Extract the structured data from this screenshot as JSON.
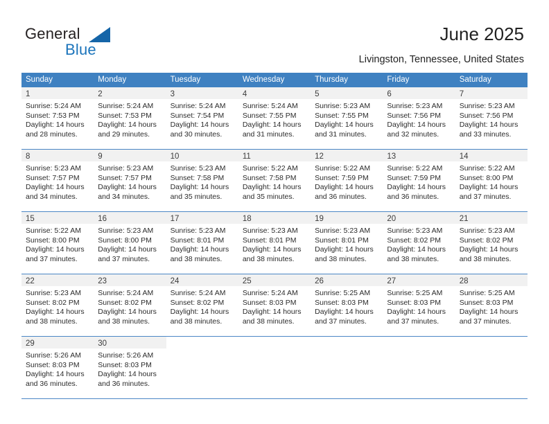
{
  "brand": {
    "name_part1": "General",
    "name_part2": "Blue",
    "accent_color": "#1b74bb",
    "triangle_color": "#1565a8"
  },
  "header": {
    "title": "June 2025",
    "location": "Livingston, Tennessee, United States"
  },
  "calendar": {
    "header_bg": "#3f81c1",
    "row_separator_color": "#4a86c5",
    "daynum_band_color": "#f1f1f1",
    "weekdays": [
      "Sunday",
      "Monday",
      "Tuesday",
      "Wednesday",
      "Thursday",
      "Friday",
      "Saturday"
    ],
    "weeks": [
      [
        {
          "day": "1",
          "sunrise": "Sunrise: 5:24 AM",
          "sunset": "Sunset: 7:53 PM",
          "daylight_line1": "Daylight: 14 hours",
          "daylight_line2": "and 28 minutes."
        },
        {
          "day": "2",
          "sunrise": "Sunrise: 5:24 AM",
          "sunset": "Sunset: 7:53 PM",
          "daylight_line1": "Daylight: 14 hours",
          "daylight_line2": "and 29 minutes."
        },
        {
          "day": "3",
          "sunrise": "Sunrise: 5:24 AM",
          "sunset": "Sunset: 7:54 PM",
          "daylight_line1": "Daylight: 14 hours",
          "daylight_line2": "and 30 minutes."
        },
        {
          "day": "4",
          "sunrise": "Sunrise: 5:24 AM",
          "sunset": "Sunset: 7:55 PM",
          "daylight_line1": "Daylight: 14 hours",
          "daylight_line2": "and 31 minutes."
        },
        {
          "day": "5",
          "sunrise": "Sunrise: 5:23 AM",
          "sunset": "Sunset: 7:55 PM",
          "daylight_line1": "Daylight: 14 hours",
          "daylight_line2": "and 31 minutes."
        },
        {
          "day": "6",
          "sunrise": "Sunrise: 5:23 AM",
          "sunset": "Sunset: 7:56 PM",
          "daylight_line1": "Daylight: 14 hours",
          "daylight_line2": "and 32 minutes."
        },
        {
          "day": "7",
          "sunrise": "Sunrise: 5:23 AM",
          "sunset": "Sunset: 7:56 PM",
          "daylight_line1": "Daylight: 14 hours",
          "daylight_line2": "and 33 minutes."
        }
      ],
      [
        {
          "day": "8",
          "sunrise": "Sunrise: 5:23 AM",
          "sunset": "Sunset: 7:57 PM",
          "daylight_line1": "Daylight: 14 hours",
          "daylight_line2": "and 34 minutes."
        },
        {
          "day": "9",
          "sunrise": "Sunrise: 5:23 AM",
          "sunset": "Sunset: 7:57 PM",
          "daylight_line1": "Daylight: 14 hours",
          "daylight_line2": "and 34 minutes."
        },
        {
          "day": "10",
          "sunrise": "Sunrise: 5:23 AM",
          "sunset": "Sunset: 7:58 PM",
          "daylight_line1": "Daylight: 14 hours",
          "daylight_line2": "and 35 minutes."
        },
        {
          "day": "11",
          "sunrise": "Sunrise: 5:22 AM",
          "sunset": "Sunset: 7:58 PM",
          "daylight_line1": "Daylight: 14 hours",
          "daylight_line2": "and 35 minutes."
        },
        {
          "day": "12",
          "sunrise": "Sunrise: 5:22 AM",
          "sunset": "Sunset: 7:59 PM",
          "daylight_line1": "Daylight: 14 hours",
          "daylight_line2": "and 36 minutes."
        },
        {
          "day": "13",
          "sunrise": "Sunrise: 5:22 AM",
          "sunset": "Sunset: 7:59 PM",
          "daylight_line1": "Daylight: 14 hours",
          "daylight_line2": "and 36 minutes."
        },
        {
          "day": "14",
          "sunrise": "Sunrise: 5:22 AM",
          "sunset": "Sunset: 8:00 PM",
          "daylight_line1": "Daylight: 14 hours",
          "daylight_line2": "and 37 minutes."
        }
      ],
      [
        {
          "day": "15",
          "sunrise": "Sunrise: 5:22 AM",
          "sunset": "Sunset: 8:00 PM",
          "daylight_line1": "Daylight: 14 hours",
          "daylight_line2": "and 37 minutes."
        },
        {
          "day": "16",
          "sunrise": "Sunrise: 5:23 AM",
          "sunset": "Sunset: 8:00 PM",
          "daylight_line1": "Daylight: 14 hours",
          "daylight_line2": "and 37 minutes."
        },
        {
          "day": "17",
          "sunrise": "Sunrise: 5:23 AM",
          "sunset": "Sunset: 8:01 PM",
          "daylight_line1": "Daylight: 14 hours",
          "daylight_line2": "and 38 minutes."
        },
        {
          "day": "18",
          "sunrise": "Sunrise: 5:23 AM",
          "sunset": "Sunset: 8:01 PM",
          "daylight_line1": "Daylight: 14 hours",
          "daylight_line2": "and 38 minutes."
        },
        {
          "day": "19",
          "sunrise": "Sunrise: 5:23 AM",
          "sunset": "Sunset: 8:01 PM",
          "daylight_line1": "Daylight: 14 hours",
          "daylight_line2": "and 38 minutes."
        },
        {
          "day": "20",
          "sunrise": "Sunrise: 5:23 AM",
          "sunset": "Sunset: 8:02 PM",
          "daylight_line1": "Daylight: 14 hours",
          "daylight_line2": "and 38 minutes."
        },
        {
          "day": "21",
          "sunrise": "Sunrise: 5:23 AM",
          "sunset": "Sunset: 8:02 PM",
          "daylight_line1": "Daylight: 14 hours",
          "daylight_line2": "and 38 minutes."
        }
      ],
      [
        {
          "day": "22",
          "sunrise": "Sunrise: 5:23 AM",
          "sunset": "Sunset: 8:02 PM",
          "daylight_line1": "Daylight: 14 hours",
          "daylight_line2": "and 38 minutes."
        },
        {
          "day": "23",
          "sunrise": "Sunrise: 5:24 AM",
          "sunset": "Sunset: 8:02 PM",
          "daylight_line1": "Daylight: 14 hours",
          "daylight_line2": "and 38 minutes."
        },
        {
          "day": "24",
          "sunrise": "Sunrise: 5:24 AM",
          "sunset": "Sunset: 8:02 PM",
          "daylight_line1": "Daylight: 14 hours",
          "daylight_line2": "and 38 minutes."
        },
        {
          "day": "25",
          "sunrise": "Sunrise: 5:24 AM",
          "sunset": "Sunset: 8:03 PM",
          "daylight_line1": "Daylight: 14 hours",
          "daylight_line2": "and 38 minutes."
        },
        {
          "day": "26",
          "sunrise": "Sunrise: 5:25 AM",
          "sunset": "Sunset: 8:03 PM",
          "daylight_line1": "Daylight: 14 hours",
          "daylight_line2": "and 37 minutes."
        },
        {
          "day": "27",
          "sunrise": "Sunrise: 5:25 AM",
          "sunset": "Sunset: 8:03 PM",
          "daylight_line1": "Daylight: 14 hours",
          "daylight_line2": "and 37 minutes."
        },
        {
          "day": "28",
          "sunrise": "Sunrise: 5:25 AM",
          "sunset": "Sunset: 8:03 PM",
          "daylight_line1": "Daylight: 14 hours",
          "daylight_line2": "and 37 minutes."
        }
      ],
      [
        {
          "day": "29",
          "sunrise": "Sunrise: 5:26 AM",
          "sunset": "Sunset: 8:03 PM",
          "daylight_line1": "Daylight: 14 hours",
          "daylight_line2": "and 36 minutes."
        },
        {
          "day": "30",
          "sunrise": "Sunrise: 5:26 AM",
          "sunset": "Sunset: 8:03 PM",
          "daylight_line1": "Daylight: 14 hours",
          "daylight_line2": "and 36 minutes."
        },
        {
          "day": "",
          "sunrise": "",
          "sunset": "",
          "daylight_line1": "",
          "daylight_line2": ""
        },
        {
          "day": "",
          "sunrise": "",
          "sunset": "",
          "daylight_line1": "",
          "daylight_line2": ""
        },
        {
          "day": "",
          "sunrise": "",
          "sunset": "",
          "daylight_line1": "",
          "daylight_line2": ""
        },
        {
          "day": "",
          "sunrise": "",
          "sunset": "",
          "daylight_line1": "",
          "daylight_line2": ""
        },
        {
          "day": "",
          "sunrise": "",
          "sunset": "",
          "daylight_line1": "",
          "daylight_line2": ""
        }
      ]
    ]
  }
}
